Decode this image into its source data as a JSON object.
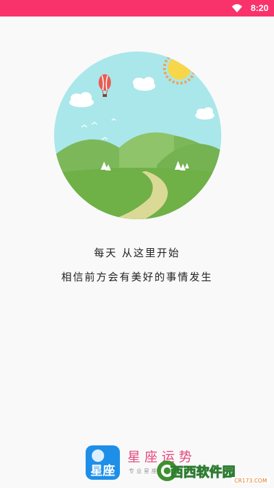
{
  "status_bar": {
    "time": "8:20",
    "icons": [
      "wifi-icon"
    ],
    "color": "#f9326c"
  },
  "slogan": {
    "line1": "每天 从这里开始",
    "line2": "相信前方会有美好的事情发生"
  },
  "brand": {
    "logo_text": "星座",
    "name": "星座运势",
    "subtitle": "专业星座运势"
  },
  "watermark": {
    "main": "西西软件园",
    "url": "CR173.COM"
  }
}
